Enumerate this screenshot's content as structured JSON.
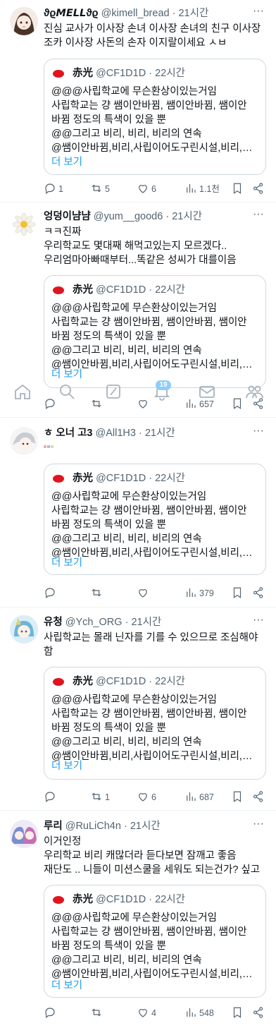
{
  "tweets": [
    {
      "name": "ϑϱ𝙈𝙀𝙇𝙇ϑϱ",
      "handle": "@kimell_bread",
      "dot": "·",
      "time": "21시간",
      "text": "진심 교사가 이사장 손녀 이사장 손녀의 친구 이사장 조카 이사장 사돈의 손자 이지랄이세요 ㅅㅂ",
      "quote": {
        "name": "赤光",
        "handle": "@CF1D1D",
        "time": "22시간",
        "lines": [
          "@@@사립학교에 무슨환상이있는거임",
          "사립학교는 걍 쌤이안바뀜, 쌤이안바뀜, 쌤이안",
          "바뀜 정도의 특색이 있을 뿐",
          "@@그리고 비리, 비리, 비리의 연속",
          "@쌤이안바뀜,비리,사립이어도구린시설,비리,…"
        ],
        "show_more": "더 보기"
      },
      "stats": {
        "reply": "1",
        "retweet": "5",
        "like": "6",
        "views": "1.1천"
      }
    },
    {
      "name": "엉덩이냠냠",
      "handle": "@yum__good6",
      "dot": "·",
      "time": "21시간",
      "text": "ㅋㅋ진짜\n우리학교도 몇대째 해먹고있는지 모르겠다..\n우리엄마아빠때부터...똑같은 성씨가 대를이음",
      "quote": {
        "name": "赤光",
        "handle": "@CF1D1D",
        "time": "22시간",
        "lines": [
          "@@@사립학교에 무슨환상이있는거임",
          "사립학교는 걍 쌤이안바뀜, 쌤이안바뀜, 쌤이안",
          "바뀜 정도의 특색이 있을 뿐",
          "@@그리고 비리, 비리, 비리의 연속",
          "@쌤이안바뀜,비리,사립이어도구린시설,비리,…"
        ],
        "show_more": "더 보기"
      },
      "stats": {
        "reply": "",
        "retweet": "",
        "like": "",
        "views": "657"
      }
    },
    {
      "name": "ㅎ 오너 고3",
      "handle": "@All1H3",
      "dot": "·",
      "time": "21시간",
      "text": "",
      "quote": {
        "name": "赤光",
        "handle": "@CF1D1D",
        "time": "22시간",
        "lines": [
          "@@사립학교에 무슨환상이있는거임",
          "사립학교는 걍 쌤이안바뀜, 쌤이안바뀜, 쌤이안",
          "바뀜 정도의 특색이 있을 뿐",
          "@@그리고 비리, 비리, 비리의 연속",
          "@쌤이안바뀜,비리,사립이어도구린시설,비리,…"
        ],
        "show_more": "더 보기"
      },
      "stats": {
        "reply": "",
        "retweet": "",
        "like": "",
        "views": "379"
      }
    },
    {
      "name": "유청",
      "handle": "@Ych_ORG",
      "dot": "·",
      "time": "21시간",
      "text": "사립학교는 몰래 닌자를 기를 수 있으므로 조심해야 함",
      "quote": {
        "name": "赤光",
        "handle": "@CF1D1D",
        "time": "22시간",
        "lines": [
          "@@@사립학교에 무슨환상이있는거임",
          "사립학교는 걍 쌤이안바뀜, 쌤이안바뀜, 쌤이안",
          "바뀜 정도의 특색이 있을 뿐",
          "@@그리고 비리, 비리, 비리의 연속",
          "@쌤이안바뀜,비리,사립이어도구린시설,비리,…"
        ],
        "show_more": "더 보기"
      },
      "stats": {
        "reply": "",
        "retweet": "1",
        "like": "6",
        "views": "687"
      }
    },
    {
      "name": "루리",
      "handle": "@RuLiCh4n",
      "dot": "·",
      "time": "21시간",
      "text": "이거인정\n우리학교 비리 캐많더라 듣다보면 잠깨고 좋음\n재단도 .. 니들이 미션스쿨을 세워도 되는건가? 싶고",
      "quote": {
        "name": "赤光",
        "handle": "@CF1D1D",
        "time": "22시간",
        "lines": [
          "@@@사립학교에 무슨환상이있는거임",
          "사립학교는 걍 쌤이안바뀜, 쌤이안바뀜, 쌤이안",
          "바뀜 정도의 특색이 있을 뿐",
          "@@그리고 비리, 비리, 비리의 연속",
          "@쌤이안바뀜,비리,사립이어도구린시설,비리,…"
        ],
        "show_more": "더 보기"
      },
      "stats": {
        "reply": "",
        "retweet": "",
        "like": "4",
        "views": "548"
      }
    }
  ],
  "bottom_nav": {
    "items": [
      "home-icon",
      "search-icon",
      "grok-icon",
      "notifications-icon",
      "messages-icon",
      "communities-icon"
    ],
    "notification_count": "19"
  },
  "colors": {
    "accent": "#1d9bf0",
    "muted": "#536471",
    "border": "#cfd9de",
    "quote_avatar": "#e0141e"
  }
}
